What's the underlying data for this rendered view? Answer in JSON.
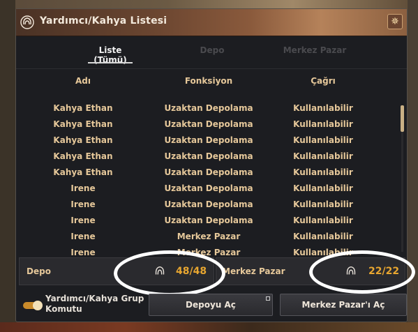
{
  "window": {
    "title": "Yardımcı/Kahya Listesi",
    "icon": "helper-portrait-icon",
    "close_icon": "close-icon"
  },
  "tabs": [
    {
      "label": "Liste (Tümü)",
      "active": true
    },
    {
      "label": "Depo",
      "active": false
    },
    {
      "label": "Merkez Pazar",
      "active": false
    }
  ],
  "table": {
    "headers": [
      "Adı",
      "Fonksiyon",
      "Çağrı"
    ],
    "rows": [
      [
        "Kahya Ethan",
        "Uzaktan Depolama",
        "Kullanılabilir"
      ],
      [
        "Kahya Ethan",
        "Uzaktan Depolama",
        "Kullanılabilir"
      ],
      [
        "Kahya Ethan",
        "Uzaktan Depolama",
        "Kullanılabilir"
      ],
      [
        "Kahya Ethan",
        "Uzaktan Depolama",
        "Kullanılabilir"
      ],
      [
        "Kahya Ethan",
        "Uzaktan Depolama",
        "Kullanılabilir"
      ],
      [
        "Irene",
        "Uzaktan Depolama",
        "Kullanılabilir"
      ],
      [
        "Irene",
        "Uzaktan Depolama",
        "Kullanılabilir"
      ],
      [
        "Irene",
        "Uzaktan Depolama",
        "Kullanılabilir"
      ],
      [
        "Irene",
        "Merkez Pazar",
        "Kullanılabilir"
      ],
      [
        "Irene",
        "Merkez Pazar",
        "Kullanılabilir"
      ]
    ]
  },
  "storage": {
    "depo": {
      "label": "Depo",
      "count": "48/48"
    },
    "pazar": {
      "label": "Merkez Pazar",
      "count": "22/22"
    }
  },
  "footer": {
    "toggle_label": "Yardımcı/Kahya Grup Komutu",
    "toggle_on": true,
    "open_depo": "Depoyu Aç",
    "open_pazar": "Merkez Pazar'ı Aç"
  },
  "colors": {
    "accent": "#e6c89a",
    "count": "#e8a630",
    "window_bg": "#1c1d21"
  }
}
